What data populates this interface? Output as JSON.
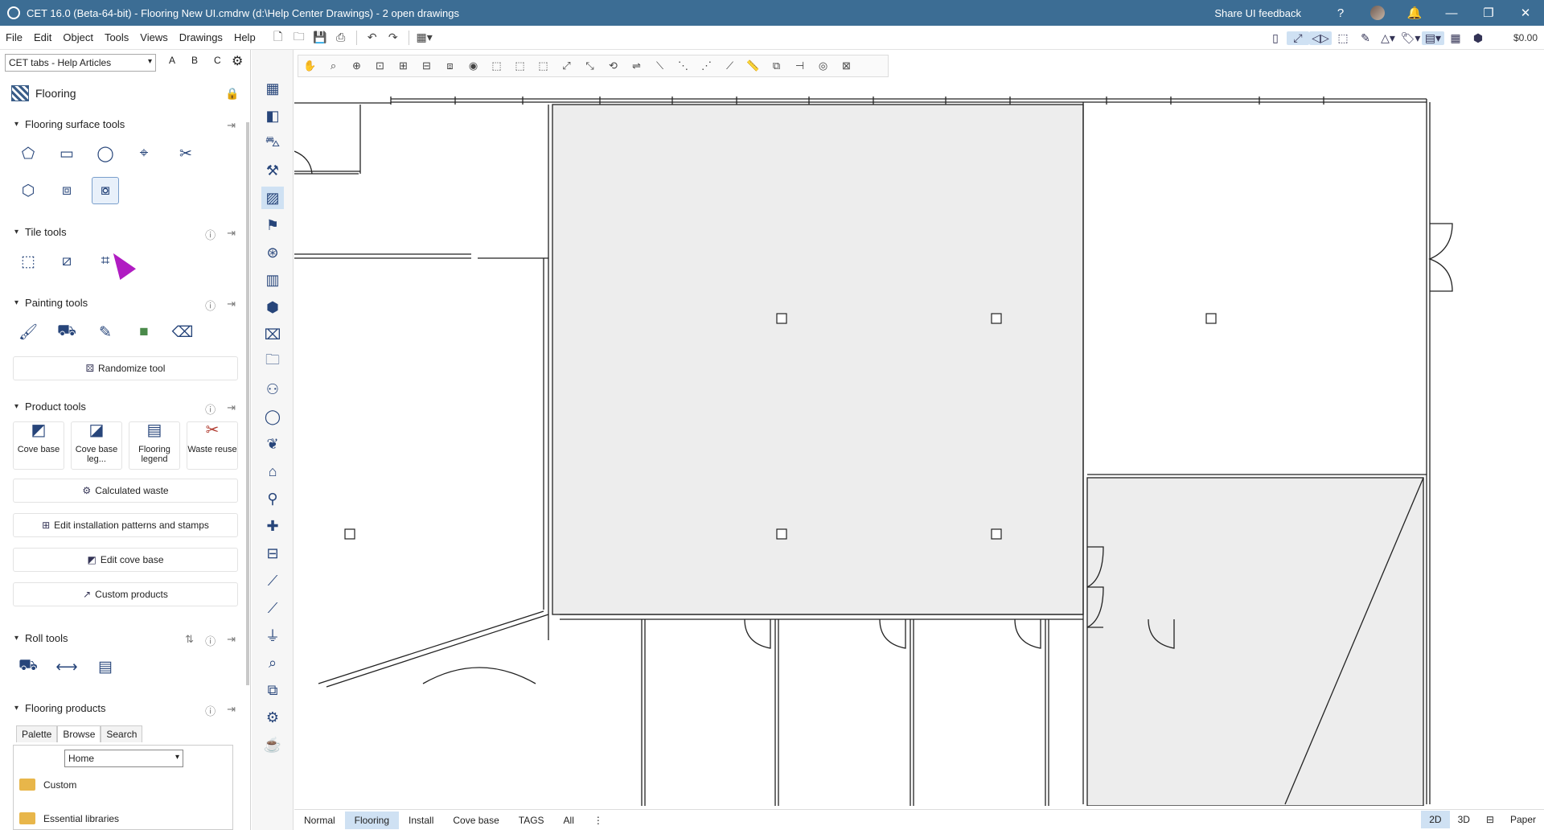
{
  "window": {
    "title": "CET 16.0 (Beta-64-bit) - Flooring New UI.cmdrw (d:\\Help Center Drawings) - 2  open drawings",
    "share_feedback": "Share UI feedback"
  },
  "menu": [
    "File",
    "Edit",
    "Object",
    "Tools",
    "Views",
    "Drawings",
    "Help"
  ],
  "toolbar": {
    "price": "$0.00"
  },
  "left_panel": {
    "tab_selector": "CET tabs - Help Articles",
    "abc": [
      "A",
      "B",
      "C"
    ],
    "panel_title": "Flooring",
    "sections": {
      "surface": "Flooring surface tools",
      "tile": "Tile tools",
      "painting": "Painting tools",
      "product": "Product tools",
      "roll": "Roll tools",
      "products": "Flooring products"
    },
    "buttons": {
      "randomize": "Randomize tool",
      "calculated_waste": "Calculated waste",
      "edit_patterns": "Edit installation patterns and stamps",
      "edit_cove": "Edit cove base",
      "custom_products": "Custom products"
    },
    "product_cards": [
      {
        "label": "Cove base",
        "icon": "cove-base-icon"
      },
      {
        "label": "Cove base leg...",
        "icon": "cove-base-legend-icon"
      },
      {
        "label": "Flooring legend",
        "icon": "flooring-legend-icon"
      },
      {
        "label": "Waste reuse",
        "icon": "waste-reuse-icon"
      }
    ],
    "product_tabs": [
      "Palette",
      "Browse",
      "Search"
    ],
    "browse_location": "Home",
    "folders": [
      "Custom",
      "Essential libraries"
    ]
  },
  "bottom_tabs": [
    "Normal",
    "Flooring",
    "Install",
    "Cove base",
    "TAGS",
    "All"
  ],
  "active_bottom_tab": "Flooring",
  "view_modes": [
    "2D",
    "3D",
    "Paper"
  ],
  "active_view_mode": "2D"
}
